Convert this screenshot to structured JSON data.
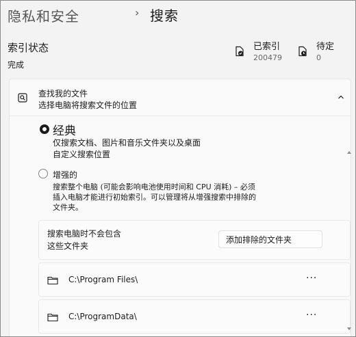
{
  "breadcrumb": {
    "parent": "隐私和安全",
    "separator": "›",
    "current": "搜索"
  },
  "index_status": {
    "title": "索引状态",
    "value": "完成",
    "indexed": {
      "label": "已索引",
      "count": "200479",
      "icon": "document-check-icon"
    },
    "pending": {
      "label": "待定",
      "count": "0",
      "icon": "document-pending-icon"
    }
  },
  "find_files": {
    "title": "查找我的文件",
    "subtitle": "选择电脑将搜索文件的位置",
    "icon": "search-files-icon",
    "expanded": true
  },
  "options": {
    "classic": {
      "title": "经典",
      "desc1": "仅搜索文档、图片和音乐文件夹以及桌面",
      "desc2": "自定义搜索位置",
      "selected": true
    },
    "enhanced": {
      "title": "增强的",
      "desc": "搜索整个电脑 (可能会影响电池使用时间和 CPU 消耗) – 必须插入电脑才能进行初始索引。可以管理将从增强搜索中排除的文件夹。",
      "selected": false
    }
  },
  "exclude": {
    "text_line1": "搜索电脑时不会包含",
    "text_line2": "这些文件夹",
    "button_label": "添加排除的文件夹"
  },
  "excluded_folders": [
    {
      "path": "C:\\Program Files\\",
      "more": "···"
    },
    {
      "path": "C:\\ProgramData\\",
      "more": "···"
    }
  ]
}
